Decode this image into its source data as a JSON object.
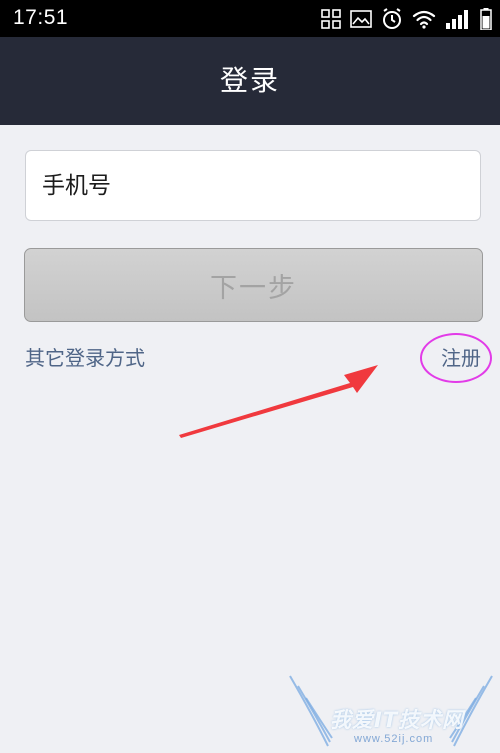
{
  "status_bar": {
    "time": "17:51",
    "icons": [
      "grid-icon",
      "image-icon",
      "alarm-icon",
      "wifi-icon",
      "signal-icon",
      "battery-icon"
    ]
  },
  "nav": {
    "title": "登录"
  },
  "form": {
    "phone_placeholder": "手机号",
    "next_label": "下一步"
  },
  "links": {
    "other_login": "其它登录方式",
    "register": "注册"
  },
  "watermark": {
    "text": "我爱IT技术网",
    "url": "www.52ij.com"
  },
  "colors": {
    "nav_bg": "#262a38",
    "page_bg": "#eff0f4",
    "link": "#4f6587",
    "annotation_circle": "#e23be8",
    "annotation_arrow": "#f0393e"
  }
}
